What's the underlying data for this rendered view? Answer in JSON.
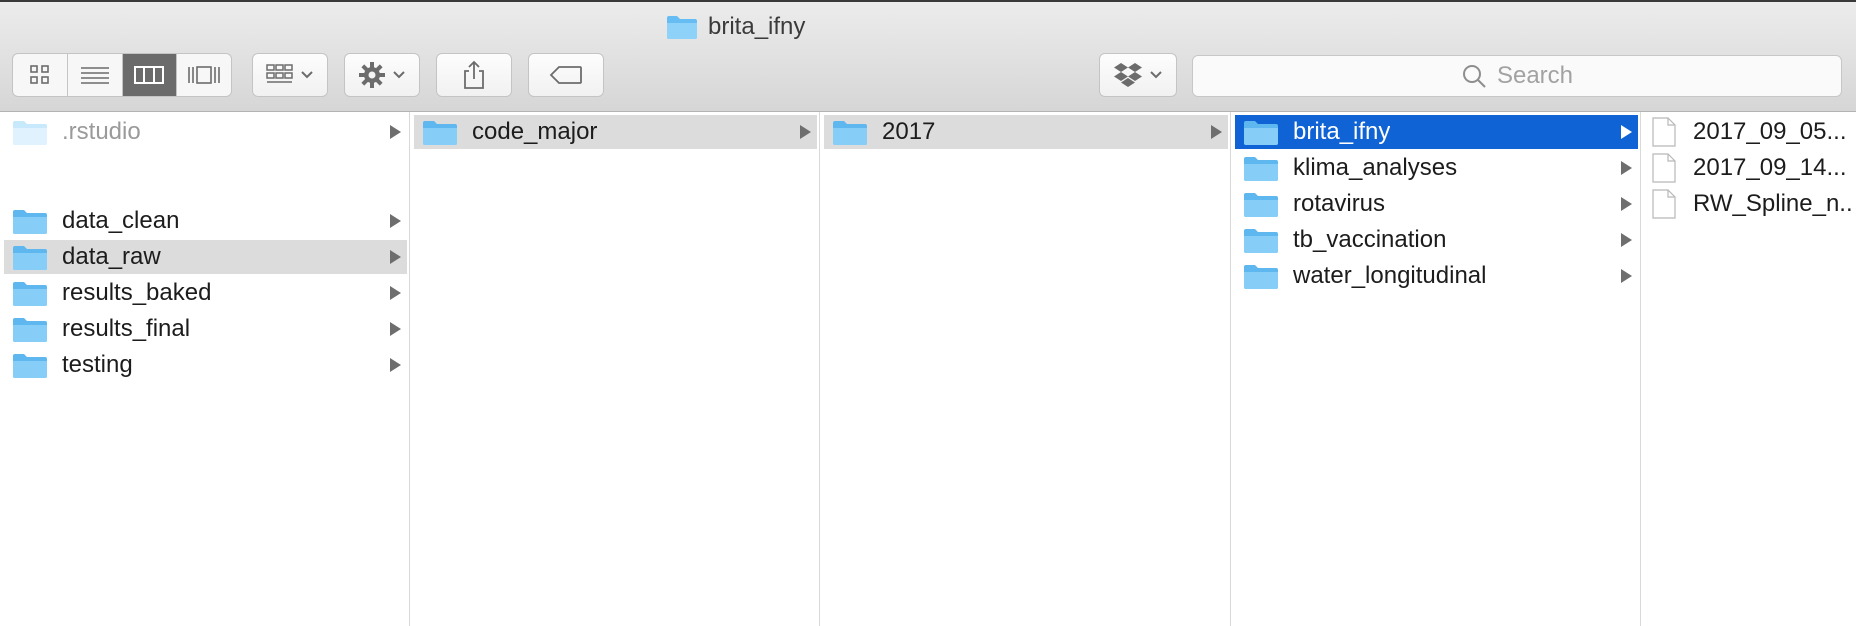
{
  "window": {
    "title": "brita_ifny",
    "title_icon": "folder-icon"
  },
  "toolbar": {
    "view_buttons": [
      {
        "name": "icon-view",
        "icon": "grid-icon",
        "active": false
      },
      {
        "name": "list-view",
        "icon": "list-icon",
        "active": false
      },
      {
        "name": "column-view",
        "icon": "columns-icon",
        "active": true
      },
      {
        "name": "gallery-view",
        "icon": "gallery-icon",
        "active": false
      }
    ],
    "arrange_icon": "arrange-icon",
    "action_icon": "gear-icon",
    "share_icon": "share-icon",
    "tag_icon": "tag-icon",
    "dropbox_icon": "dropbox-icon",
    "search": {
      "placeholder": "Search",
      "icon": "search-icon"
    }
  },
  "columns": [
    {
      "items": [
        {
          "label": ".rstudio",
          "type": "folder",
          "hidden": true,
          "selected": ""
        },
        {
          "label": "data_clean",
          "type": "folder",
          "hidden": false,
          "selected": ""
        },
        {
          "label": "data_raw",
          "type": "folder",
          "hidden": false,
          "selected": "gray"
        },
        {
          "label": "results_baked",
          "type": "folder",
          "hidden": false,
          "selected": ""
        },
        {
          "label": "results_final",
          "type": "folder",
          "hidden": false,
          "selected": ""
        },
        {
          "label": "testing",
          "type": "folder",
          "hidden": false,
          "selected": ""
        }
      ]
    },
    {
      "items": [
        {
          "label": "code_major",
          "type": "folder",
          "selected": "gray"
        }
      ]
    },
    {
      "items": [
        {
          "label": "2017",
          "type": "folder",
          "selected": "gray"
        }
      ]
    },
    {
      "items": [
        {
          "label": "brita_ifny",
          "type": "folder",
          "selected": "blue"
        },
        {
          "label": "klima_analyses",
          "type": "folder",
          "selected": ""
        },
        {
          "label": "rotavirus",
          "type": "folder",
          "selected": ""
        },
        {
          "label": "tb_vaccination",
          "type": "folder",
          "selected": ""
        },
        {
          "label": "water_longitudinal",
          "type": "folder",
          "selected": ""
        }
      ]
    },
    {
      "items": [
        {
          "label": "2017_09_05...",
          "type": "file",
          "selected": ""
        },
        {
          "label": "2017_09_14...",
          "type": "file",
          "selected": ""
        },
        {
          "label": "RW_Spline_n...",
          "type": "file",
          "selected": ""
        }
      ]
    }
  ],
  "colors": {
    "selection_blue": "#0f63d4",
    "selection_gray": "#dcdcdc",
    "folder_blue": "#6ec3f6"
  }
}
